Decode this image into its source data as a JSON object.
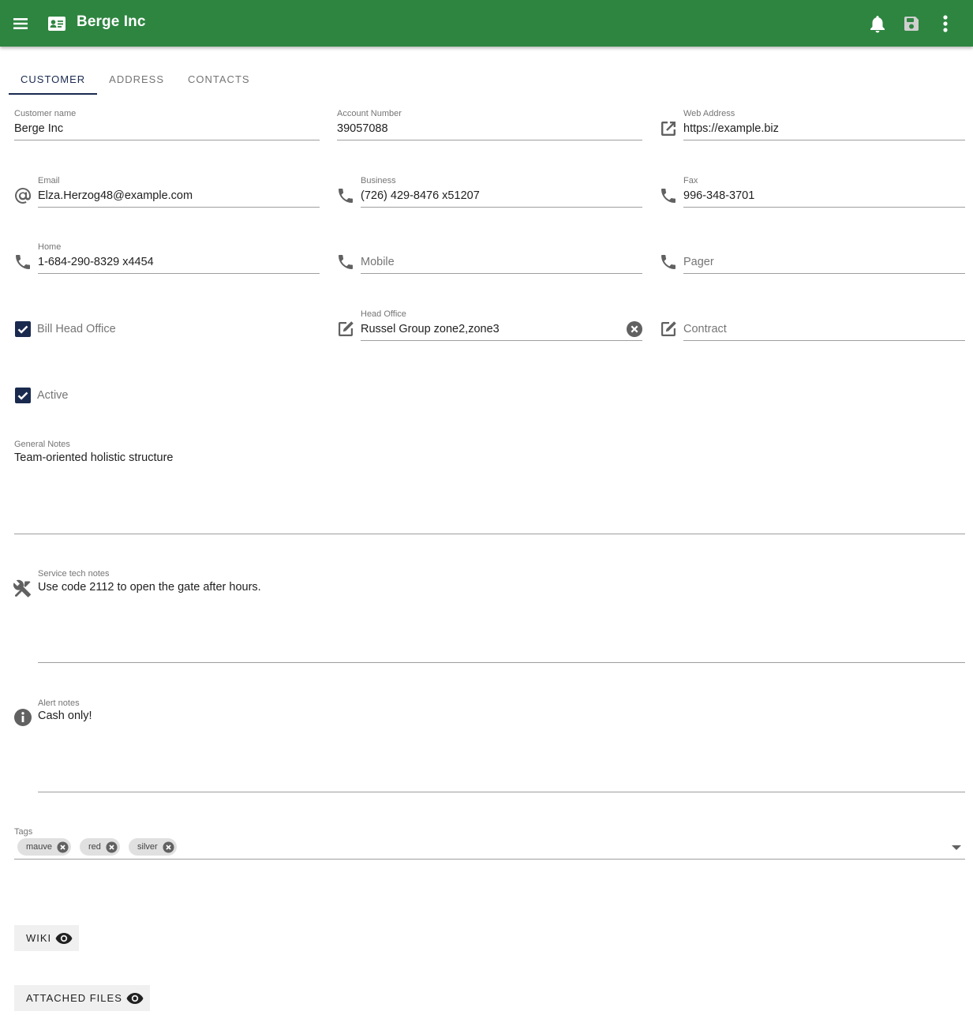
{
  "app": {
    "title": "Berge Inc"
  },
  "tabs": [
    {
      "label": "CUSTOMER",
      "active": true
    },
    {
      "label": "ADDRESS",
      "active": false
    },
    {
      "label": "CONTACTS",
      "active": false
    }
  ],
  "fields": {
    "customer_name": {
      "label": "Customer name",
      "value": "Berge Inc"
    },
    "account_number": {
      "label": "Account Number",
      "value": "39057088"
    },
    "web_address": {
      "label": "Web Address",
      "value": "https://example.biz"
    },
    "email": {
      "label": "Email",
      "value": "Elza.Herzog48@example.com"
    },
    "business": {
      "label": "Business",
      "value": "(726) 429-8476 x51207"
    },
    "fax": {
      "label": "Fax",
      "value": "996-348-3701"
    },
    "home": {
      "label": "Home",
      "value": "1-684-290-8329 x4454"
    },
    "mobile": {
      "placeholder": "Mobile"
    },
    "pager": {
      "placeholder": "Pager"
    },
    "head_office": {
      "label": "Head Office",
      "value": "Russel Group zone2,zone3"
    },
    "contract": {
      "placeholder": "Contract"
    },
    "general_notes": {
      "label": "General Notes",
      "value": "Team-oriented holistic structure"
    },
    "service_tech_notes": {
      "label": "Service tech notes",
      "value": "Use code 2112 to open the gate after hours."
    },
    "alert_notes": {
      "label": "Alert notes",
      "value": "Cash only!"
    },
    "tags": {
      "label": "Tags",
      "items": [
        "mauve",
        "red",
        "silver"
      ]
    }
  },
  "checkboxes": {
    "bill_head_office": {
      "label": "Bill Head Office",
      "checked": true
    },
    "active": {
      "label": "Active",
      "checked": true
    }
  },
  "buttons": {
    "wiki": "WIKI",
    "attached_files": "ATTACHED FILES"
  },
  "colors": {
    "appbar": "#2e8540",
    "accent": "#1a2a4f"
  },
  "icons": {
    "menu": "menu-icon",
    "card": "contact-card-icon",
    "bell": "bell-icon",
    "save": "save-icon",
    "more": "more-vert-icon"
  }
}
